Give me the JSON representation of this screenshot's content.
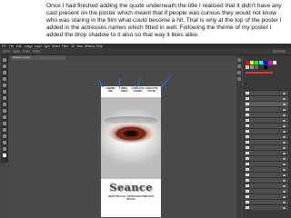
{
  "caption": "Once I had finished adding the quote underneath the title I realised that it didn't have any cast present on the poster which meant that if people was curious they would not know who was staring in the film what could become a hit. That is why at the top of the poster I added in the actresses names which fitted in well. Following the theme of my poster I added the drop shadow to it also so that way it likes alike.",
  "app": {
    "menu": [
      "PS",
      "File",
      "Edit",
      "Image",
      "Layer",
      "Type",
      "Select",
      "Filter",
      "3D",
      "View",
      "Window",
      "Help"
    ],
    "doc_tab": "Seance poster"
  },
  "poster": {
    "cast": [
      "CHERRIE DEE",
      "EMMA JONES",
      "CHARLOTTE CASSIDY",
      "CHARLOTTE TAYLOR"
    ],
    "title": "Seance",
    "quote": "WHAT WE CALL UPON IS BEYOND OUR REALM"
  },
  "colors": {
    "arrow": "#1f6fff",
    "workspace": "#474747",
    "panel": "#3a3a3a"
  },
  "icons": {
    "tools": "toolbox-icons",
    "layer_visibility": "eye-icon"
  }
}
